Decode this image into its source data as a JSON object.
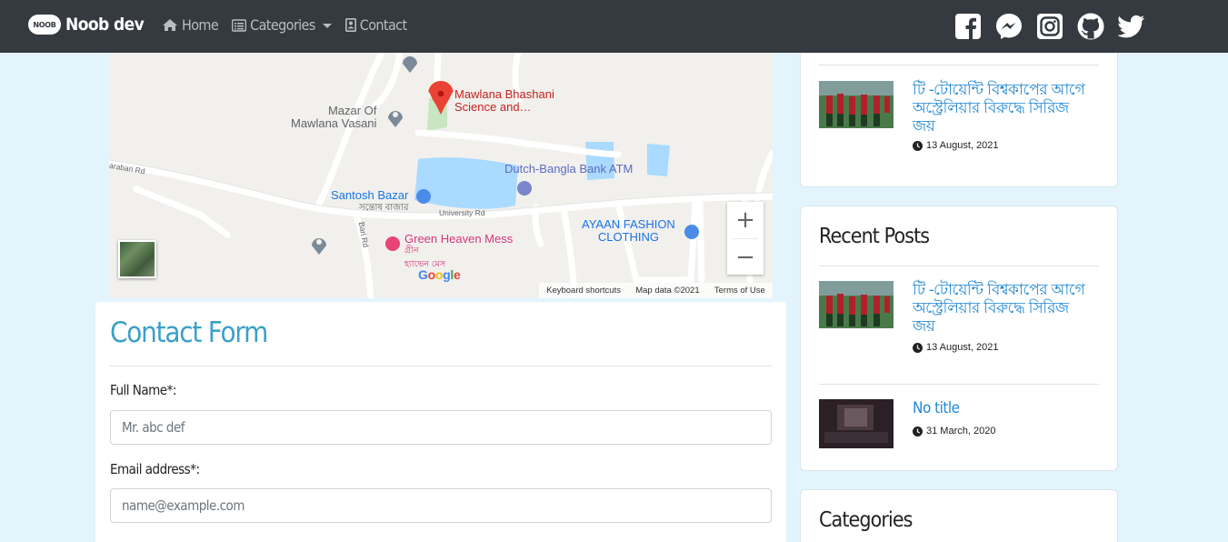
{
  "navbar": {
    "brand_logo_text": "NOOB",
    "brand_name": "Noob dev",
    "links": [
      {
        "label": "Home",
        "icon": "home-icon"
      },
      {
        "label": "Categories",
        "icon": "list-icon"
      },
      {
        "label": "Contact",
        "icon": "contact-card-icon"
      }
    ],
    "socials": [
      "facebook-icon",
      "messenger-icon",
      "instagram-icon",
      "github-icon",
      "twitter-icon"
    ]
  },
  "map": {
    "places": {
      "mawlana": "Mawlana Bhashani\nScience and…",
      "mazar": "Mazar Of\nMawlana Vasani",
      "dutch_bangla": "Dutch-Bangla Bank ATM",
      "santosh": "Santosh Bazar",
      "santosh_bn": "সন্তোষ বাজার",
      "ayaan": "AYAAN FASHION\nCLOTHING",
      "green_heaven": "Green Heaven Mess",
      "green_heaven_bn": "গ্রীন\nহ্যাভেন মেস"
    },
    "roads": {
      "parabari": "arabari Rd",
      "university": "University Rd",
      "bari": "Bari Rd"
    },
    "zoom_in": "+",
    "zoom_out": "−",
    "google": "Google",
    "footer": {
      "shortcuts": "Keyboard shortcuts",
      "data": "Map data ©2021",
      "terms": "Terms of Use"
    }
  },
  "contact": {
    "title": "Contact Form",
    "name_label": "Full Name*:",
    "name_placeholder": "Mr. abc def",
    "email_label": "Email address*:",
    "email_placeholder": "name@example.com"
  },
  "sidebar": {
    "top_post": {
      "title": "টি -টোয়েন্টি বিশ্বকাপের আগে অস্ট্রেলিয়ার বিরুদ্ধে সিরিজ জয়",
      "date": "13 August, 2021"
    },
    "recent": {
      "title": "Recent Posts",
      "posts": [
        {
          "title": "টি -টোয়েন্টি বিশ্বকাপের আগে অস্ট্রেলিয়ার বিরুদ্ধে সিরিজ জয়",
          "date": "13 August, 2021"
        },
        {
          "title": "No title",
          "date": "31 March, 2020"
        }
      ]
    },
    "categories": {
      "title": "Categories"
    }
  },
  "colors": {
    "navbar": "#343a40",
    "page_bg": "#e3f4fc",
    "accent_title": "#3aa0c8",
    "link": "#1e88d6"
  }
}
